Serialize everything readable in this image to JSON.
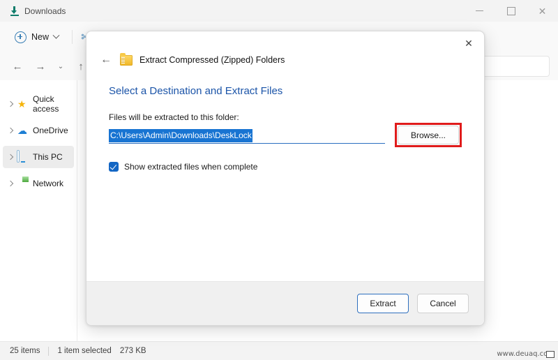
{
  "window": {
    "tab_title": "Downloads",
    "tab_icon": "download-icon",
    "controls": {
      "minimize": "minimize-icon",
      "maximize": "maximize-icon",
      "close": "close-icon"
    }
  },
  "toolbar": {
    "new_label": "New",
    "new_icon": "plus-circle-icon",
    "new_chevron": "chevron-down-icon",
    "cut_icon": "scissors-icon"
  },
  "navbar": {
    "back_icon": "←",
    "forward_icon": "→",
    "recent_icon": "⌄",
    "up_icon": "↑",
    "address_value": "",
    "search_value": "",
    "search_placeholder": ""
  },
  "sidebar": {
    "items": [
      {
        "label": "Quick access",
        "icon": "star-icon",
        "selected": false
      },
      {
        "label": "OneDrive",
        "icon": "cloud-icon",
        "selected": false
      },
      {
        "label": "This PC",
        "icon": "monitor-icon",
        "selected": true
      },
      {
        "label": "Network",
        "icon": "network-icon",
        "selected": false
      }
    ]
  },
  "statusbar": {
    "item_count": "25 items",
    "selection": "1 item selected",
    "size": "273 KB",
    "watermark": "www.deuaq.com"
  },
  "dialog": {
    "title": "Extract Compressed (Zipped) Folders",
    "title_icon": "zip-folder-icon",
    "back_icon": "back-arrow-icon",
    "close_icon": "close-icon",
    "heading": "Select a Destination and Extract Files",
    "path_label": "Files will be extracted to this folder:",
    "path_value": "C:\\Users\\Admin\\Downloads\\DeskLock",
    "browse_label": "Browse...",
    "checkbox_label": "Show extracted files when complete",
    "checkbox_checked": true,
    "extract_label": "Extract",
    "cancel_label": "Cancel",
    "annotation_color": "#e01b1b",
    "selection_color": "#1874d2",
    "heading_color": "#1b54a8"
  }
}
